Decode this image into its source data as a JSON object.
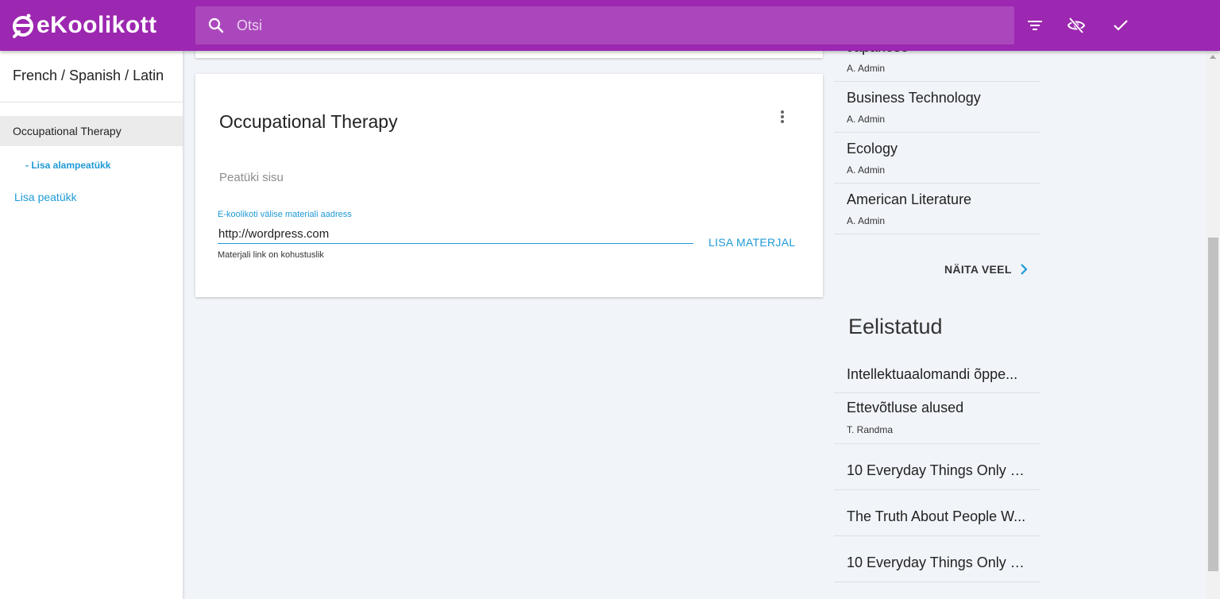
{
  "app": {
    "brand": "eKoolikott",
    "colors": {
      "primary": "#9c27b0",
      "search_bg": "#ab47bc",
      "accent": "#1e9ad6",
      "background": "#f1f4f9"
    }
  },
  "header": {
    "search_placeholder": "Otsi",
    "icons": [
      "search-icon",
      "filter-icon",
      "visibility-off-icon",
      "check-icon"
    ]
  },
  "sidebar": {
    "title": "French / Spanish / Latin",
    "chapter": "Occupational Therapy",
    "add_subchapter": "- Lisa alampeatükk",
    "add_chapter": "Lisa peatükk"
  },
  "chapter_card": {
    "title": "Occupational Therapy",
    "content_placeholder": "Peatüki sisu",
    "material_field": {
      "label": "E-koolikoti välise materiali aadress",
      "value": "http://wordpress.com",
      "helper": "Materjali link on kohustuslik"
    },
    "add_material": "LISA MATERJAL"
  },
  "right_panel": {
    "recent": [
      {
        "title": "Japanese",
        "author": "A. Admin"
      },
      {
        "title": "Business Technology",
        "author": "A. Admin"
      },
      {
        "title": "Ecology",
        "author": "A. Admin"
      },
      {
        "title": "American Literature",
        "author": "A. Admin"
      }
    ],
    "show_more": "NÄITA VEEL",
    "favorites_heading": "Eelistatud",
    "favorites": [
      {
        "title": "Intellektuaalomandi õppe...",
        "author": ""
      },
      {
        "title": "Ettevõtluse alused",
        "author": "T. Randma"
      },
      {
        "title": "10 Everyday Things Only E...",
        "author": ""
      },
      {
        "title": "The Truth About People W...",
        "author": ""
      },
      {
        "title": "10 Everyday Things Only E...",
        "author": ""
      }
    ]
  }
}
